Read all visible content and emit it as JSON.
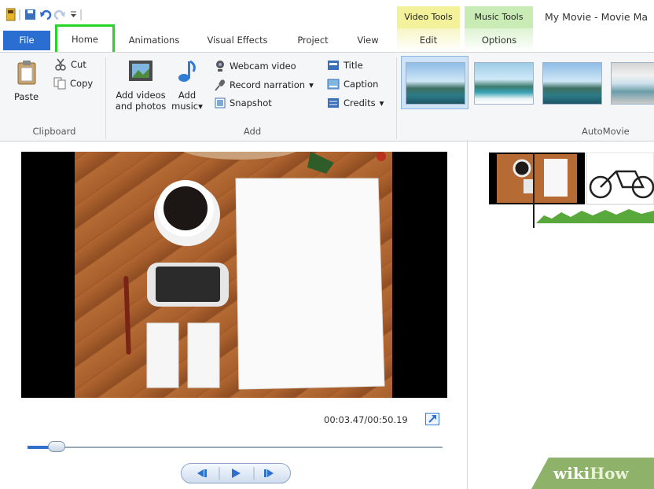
{
  "qat": {
    "icons": [
      "app-icon",
      "save-icon",
      "undo-icon",
      "redo-icon",
      "customize-icon"
    ]
  },
  "window": {
    "title": "My Movie - Movie Ma"
  },
  "contextual": {
    "video_tools": "Video Tools",
    "music_tools": "Music Tools"
  },
  "tabs": {
    "file": "File",
    "home": "Home",
    "animations": "Animations",
    "visual_effects": "Visual Effects",
    "project": "Project",
    "view": "View",
    "edit": "Edit",
    "options": "Options"
  },
  "ribbon": {
    "clipboard": {
      "paste": "Paste",
      "cut": "Cut",
      "copy": "Copy",
      "label": "Clipboard"
    },
    "add": {
      "add_videos_1": "Add videos",
      "add_videos_2": "and photos",
      "add_music_1": "Add",
      "add_music_2": "music",
      "webcam": "Webcam video",
      "narration": "Record narration",
      "snapshot": "Snapshot",
      "title": "Title",
      "caption": "Caption",
      "credits": "Credits",
      "label": "Add"
    },
    "automovie": {
      "label": "AutoMovie"
    }
  },
  "player": {
    "timecode": "00:03.47/00:50.19",
    "progress": 0.07
  },
  "watermark": {
    "wiki": "wiki",
    "how": "How"
  },
  "colors": {
    "file_tab": "#2a6ed1",
    "highlight": "#27d527",
    "video_tools": "#f3f19a",
    "music_tools": "#c9ecb6"
  }
}
